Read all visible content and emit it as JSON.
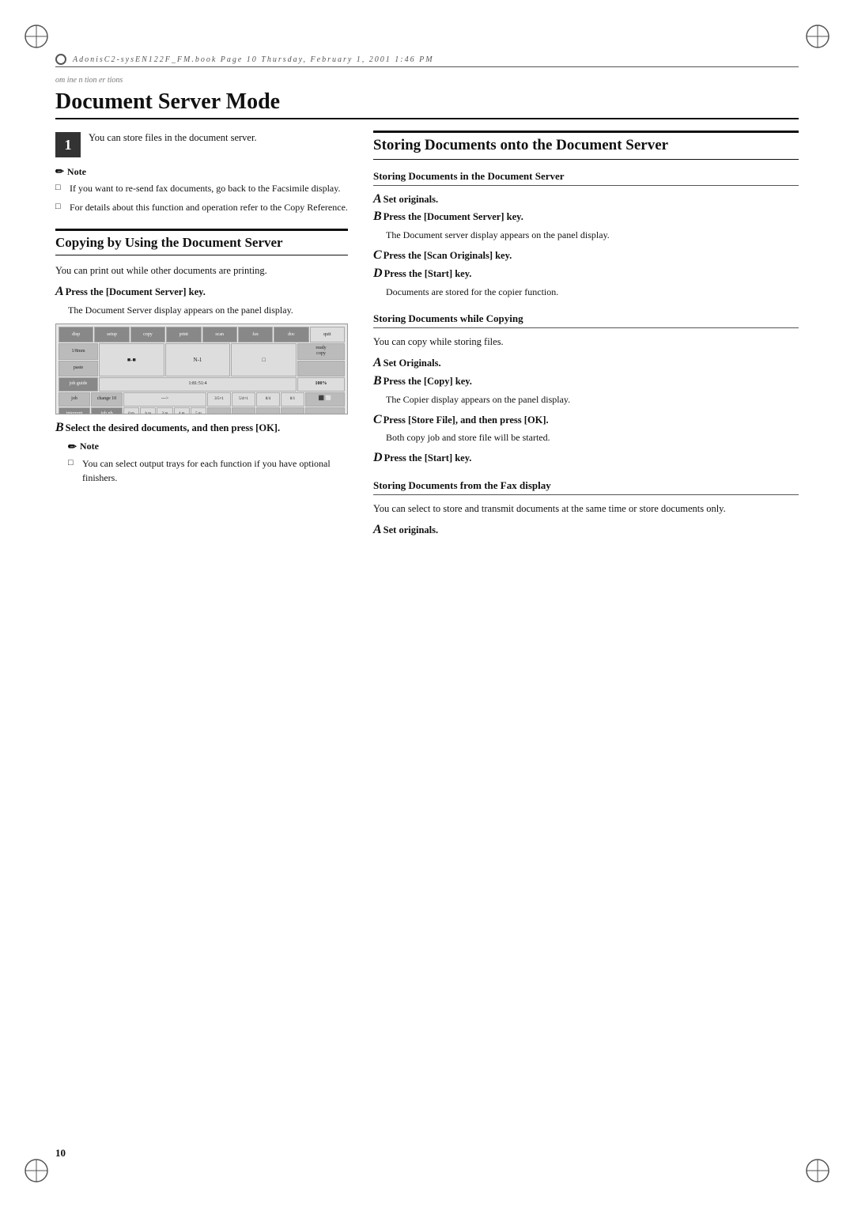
{
  "page": {
    "title": "Document Server Mode",
    "header": {
      "breadcrumb": "om ine    n tion    er tions",
      "file": "AdonisC2-sysEN122F_FM.book  Page 10  Thursday, February 1, 2001  1:46 PM",
      "page_number": "10"
    },
    "left_col": {
      "intro_text": "You can store files in the document server.",
      "note_label": "Note",
      "note_items": [
        "If you want to re-send fax documents, go back to the Facsimile display.",
        "For details about this function and operation refer to the Copy Reference."
      ],
      "section_heading": "Copying by Using the Document Server",
      "section_body": "You can print out while other documents are printing.",
      "step_a_label": "A",
      "step_a_text": "Press the [Document Server] key.",
      "step_a_body": "The Document Server display appears on the panel display.",
      "step_b_label": "B",
      "step_b_text": "Select the desired documents, and then press [OK].",
      "note2_label": "Note",
      "note2_items": [
        "You can select output trays for each function if you have optional finishers."
      ]
    },
    "right_col": {
      "main_heading": "Storing Documents onto the Document Server",
      "sub_heading1": "Storing Documents in the Document Server",
      "step_a_label": "A",
      "step_a_text": "Set originals.",
      "step_b_label": "B",
      "step_b_text": "Press the [Document Server] key.",
      "step_b_body": "The Document server display appears on the panel display.",
      "step_c_label": "C",
      "step_c_text": "Press the [Scan Originals] key.",
      "step_d_label": "D",
      "step_d_text": "Press the [Start] key.",
      "step_d_body": "Documents are stored for the copier function.",
      "sub_heading2": "Storing Documents while Copying",
      "sub2_body": "You can copy while storing files.",
      "sub2_step_a_label": "A",
      "sub2_step_a_text": "Set Originals.",
      "sub2_step_b_label": "B",
      "sub2_step_b_text": "Press the [Copy] key.",
      "sub2_step_b_body": "The Copier display appears on the panel display.",
      "sub2_step_c_label": "C",
      "sub2_step_c_text": "Press [Store File], and then press [OK].",
      "sub2_step_c_body": "Both copy job and store file will be started.",
      "sub2_step_d_label": "D",
      "sub2_step_d_text": "Press the [Start] key.",
      "sub_heading3": "Storing Documents from the Fax display",
      "sub3_body": "You can select to store and transmit documents at the same time or store documents only.",
      "sub3_step_a_label": "A",
      "sub3_step_a_text": "Set originals."
    }
  }
}
